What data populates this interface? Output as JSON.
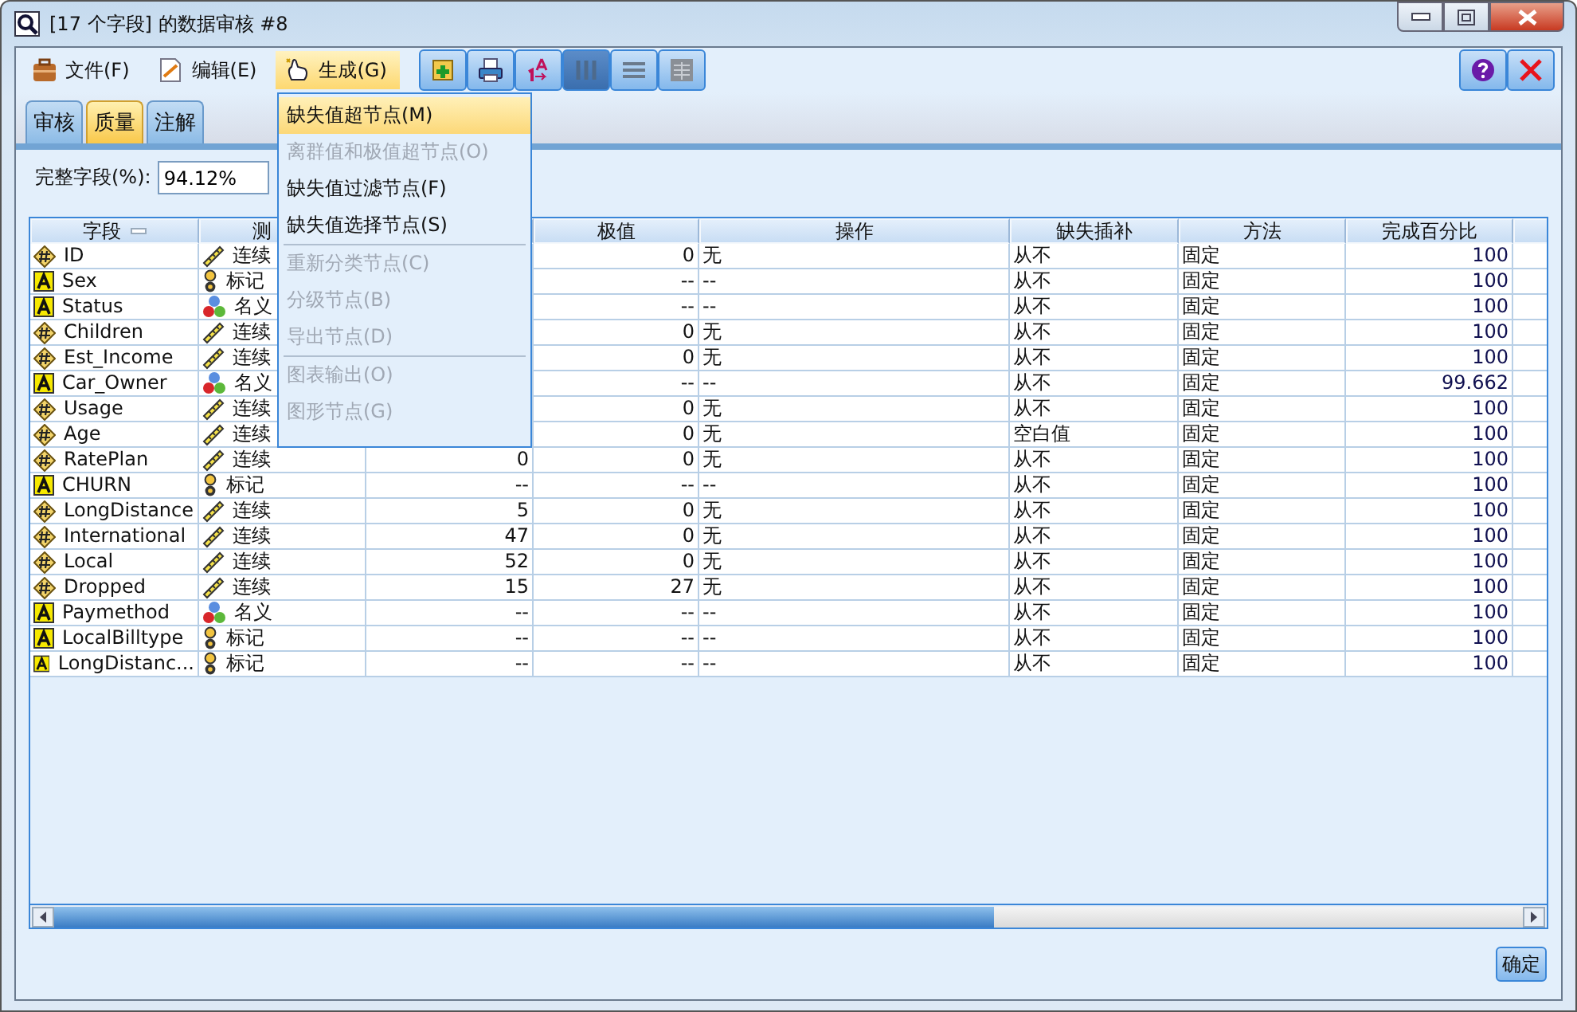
{
  "window": {
    "title": "[17 个字段] 的数据审核 #8"
  },
  "menu_bar": [
    {
      "label": "文件(F)",
      "kind": "file",
      "selected": false
    },
    {
      "label": "编辑(E)",
      "kind": "edit",
      "selected": false
    },
    {
      "label": "生成(G)",
      "kind": "generate",
      "selected": true
    }
  ],
  "menu": [
    {
      "kind": "item",
      "label": "缺失值超节点(M)",
      "selected": true,
      "disabled": false
    },
    {
      "kind": "item",
      "label": "离群值和极值超节点(O)",
      "selected": false,
      "disabled": true
    },
    {
      "kind": "item",
      "label": "缺失值过滤节点(F)",
      "selected": false,
      "disabled": false
    },
    {
      "kind": "item",
      "label": "缺失值选择节点(S)",
      "selected": false,
      "disabled": false
    },
    {
      "kind": "separator"
    },
    {
      "kind": "item",
      "label": "重新分类节点(C)",
      "selected": false,
      "disabled": true
    },
    {
      "kind": "item",
      "label": "分级节点(B)",
      "selected": false,
      "disabled": true
    },
    {
      "kind": "item",
      "label": "导出节点(D)",
      "selected": false,
      "disabled": true
    },
    {
      "kind": "separator"
    },
    {
      "kind": "item",
      "label": "图表输出(O)",
      "selected": false,
      "disabled": true
    },
    {
      "kind": "item",
      "label": "图形节点(G)",
      "selected": false,
      "disabled": true
    }
  ],
  "tabs": [
    {
      "label": "审核",
      "selected": false
    },
    {
      "label": "质量",
      "selected": true
    },
    {
      "label": "注解",
      "selected": false
    }
  ],
  "complete_fields": {
    "label": "完整字段(%):",
    "value": "94.12%"
  },
  "table": {
    "columns": [
      "字段",
      "测",
      "极值",
      "操作",
      "缺失插补",
      "方法",
      "完成百分比"
    ],
    "rows": [
      {
        "field": {
          "label": "ID",
          "kind": "number"
        },
        "measure": {
          "label": "连续",
          "kind": "continuous"
        },
        "extremes": "0",
        "action": "无",
        "impute": "从不",
        "method": "固定",
        "percent": "100"
      },
      {
        "field": {
          "label": "Sex",
          "kind": "string"
        },
        "measure": {
          "label": "标记",
          "kind": "flag"
        },
        "extremes": "--",
        "action": "--",
        "impute": "从不",
        "method": "固定",
        "percent": "100"
      },
      {
        "field": {
          "label": "Status",
          "kind": "string"
        },
        "measure": {
          "label": "名义",
          "kind": "nominal"
        },
        "extremes": "--",
        "action": "--",
        "impute": "从不",
        "method": "固定",
        "percent": "100"
      },
      {
        "field": {
          "label": "Children",
          "kind": "number"
        },
        "measure": {
          "label": "连续",
          "kind": "continuous"
        },
        "extremes": "0",
        "action": "无",
        "impute": "从不",
        "method": "固定",
        "percent": "100"
      },
      {
        "field": {
          "label": "Est_Income",
          "kind": "number"
        },
        "measure": {
          "label": "连续",
          "kind": "continuous"
        },
        "extremes": "0",
        "action": "无",
        "impute": "从不",
        "method": "固定",
        "percent": "100"
      },
      {
        "field": {
          "label": "Car_Owner",
          "kind": "string"
        },
        "measure": {
          "label": "名义",
          "kind": "nominal"
        },
        "extremes": "--",
        "action": "--",
        "impute": "从不",
        "method": "固定",
        "percent": "99.662"
      },
      {
        "field": {
          "label": "Usage",
          "kind": "number"
        },
        "measure": {
          "label": "连续",
          "kind": "continuous"
        },
        "extremes": "0",
        "action": "无",
        "impute": "从不",
        "method": "固定",
        "percent": "100"
      },
      {
        "field": {
          "label": "Age",
          "kind": "number"
        },
        "measure": {
          "label": "连续",
          "kind": "continuous"
        },
        "extremes": "0",
        "action": "无",
        "impute": "空白值",
        "method": "固定",
        "percent": "100"
      },
      {
        "field": {
          "label": "RatePlan",
          "kind": "number"
        },
        "measure": {
          "label": "连续",
          "kind": "continuous"
        },
        "column_3": "0",
        "extremes": "0",
        "action": "无",
        "impute": "从不",
        "method": "固定",
        "percent": "100"
      },
      {
        "field": {
          "label": "CHURN",
          "kind": "string"
        },
        "measure": {
          "label": "标记",
          "kind": "flag"
        },
        "column_3": "--",
        "extremes": "--",
        "action": "--",
        "impute": "从不",
        "method": "固定",
        "percent": "100"
      },
      {
        "field": {
          "label": "LongDistance",
          "kind": "number"
        },
        "measure": {
          "label": "连续",
          "kind": "continuous"
        },
        "column_3": "5",
        "extremes": "0",
        "action": "无",
        "impute": "从不",
        "method": "固定",
        "percent": "100"
      },
      {
        "field": {
          "label": "International",
          "kind": "number"
        },
        "measure": {
          "label": "连续",
          "kind": "continuous"
        },
        "column_3": "47",
        "extremes": "0",
        "action": "无",
        "impute": "从不",
        "method": "固定",
        "percent": "100"
      },
      {
        "field": {
          "label": "Local",
          "kind": "number"
        },
        "measure": {
          "label": "连续",
          "kind": "continuous"
        },
        "column_3": "52",
        "extremes": "0",
        "action": "无",
        "impute": "从不",
        "method": "固定",
        "percent": "100"
      },
      {
        "field": {
          "label": "Dropped",
          "kind": "number"
        },
        "measure": {
          "label": "连续",
          "kind": "continuous"
        },
        "column_3": "15",
        "extremes": "27",
        "action": "无",
        "impute": "从不",
        "method": "固定",
        "percent": "100"
      },
      {
        "field": {
          "label": "Paymethod",
          "kind": "string"
        },
        "measure": {
          "label": "名义",
          "kind": "nominal"
        },
        "column_3": "--",
        "extremes": "--",
        "action": "--",
        "impute": "从不",
        "method": "固定",
        "percent": "100"
      },
      {
        "field": {
          "label": "LocalBilltype",
          "kind": "string"
        },
        "measure": {
          "label": "标记",
          "kind": "flag"
        },
        "column_3": "--",
        "extremes": "--",
        "action": "--",
        "impute": "从不",
        "method": "固定",
        "percent": "100"
      },
      {
        "field": {
          "label": "LongDistanc...",
          "kind": "string"
        },
        "measure": {
          "label": "标记",
          "kind": "flag"
        },
        "column_3": "--",
        "extremes": "--",
        "action": "--",
        "impute": "从不",
        "method": "固定",
        "percent": "100"
      }
    ]
  },
  "ok_button": "确定"
}
